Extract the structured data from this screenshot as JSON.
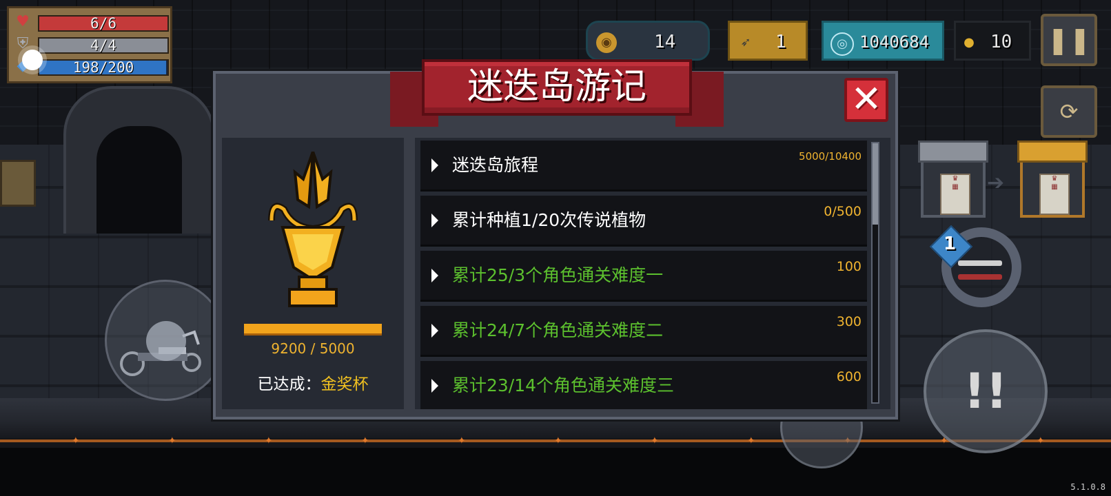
{
  "hud": {
    "health": "6/6",
    "health_fill": 1.0,
    "armor": "4/4",
    "armor_fill": 1.0,
    "energy": "198/200",
    "energy_fill": 0.99,
    "icons": {
      "health": "heart-icon",
      "armor": "shield-icon",
      "energy": "energy-crystal-icon"
    }
  },
  "resources": {
    "materials": "14",
    "fish": "1",
    "gems": "1040684",
    "coins": "10"
  },
  "modal": {
    "title": "迷迭岛游记",
    "trophy": {
      "progress": "9200 / 5000",
      "achieved_label": "已达成：",
      "achieved_value": "金奖杯"
    },
    "quests": [
      {
        "label": "迷迭岛旅程",
        "reward": "5000/10400",
        "color": "#ffffff"
      },
      {
        "label": "累计种植1/20次传说植物",
        "reward": "0/500",
        "color": "#ffffff"
      },
      {
        "label": "累计25/3个角色通关难度一",
        "reward": "100",
        "color": "#5cc02e"
      },
      {
        "label": "累计24/7个角色通关难度二",
        "reward": "300",
        "color": "#5cc02e"
      },
      {
        "label": "累计23/14个角色通关难度三",
        "reward": "600",
        "color": "#5cc02e"
      }
    ]
  },
  "weapon_slot": "1",
  "version": "5.1.0.8",
  "colors": {
    "health": "#c43a3a",
    "armor": "#8a8e96",
    "energy": "#2f74c4",
    "gold_text": "#f0b430",
    "completed_quest": "#5cc02e",
    "title_ribbon": "#a2232d"
  }
}
